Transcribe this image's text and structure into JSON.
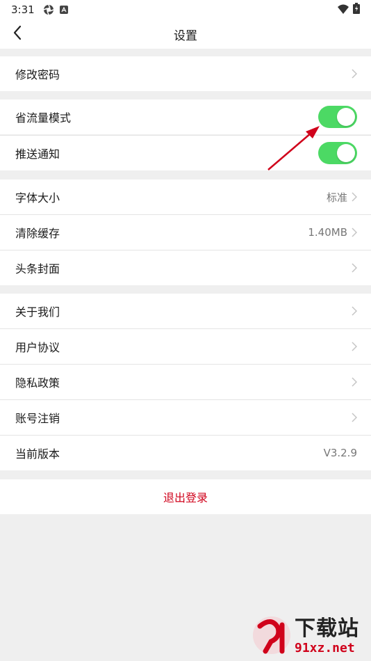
{
  "status_bar": {
    "time": "3:31"
  },
  "header": {
    "title": "设置"
  },
  "account": {
    "change_password": "修改密码"
  },
  "toggles": [
    {
      "label": "省流量模式",
      "on": true
    },
    {
      "label": "推送通知",
      "on": true
    }
  ],
  "display": {
    "font_size": {
      "label": "字体大小",
      "value": "标准"
    },
    "clear_cache": {
      "label": "清除缓存",
      "value": "1.40MB"
    },
    "headline_cover": {
      "label": "头条封面"
    }
  },
  "about": {
    "about_us": "关于我们",
    "user_agreement": "用户协议",
    "privacy_policy": "隐私政策",
    "account_cancel": "账号注销",
    "version": {
      "label": "当前版本",
      "value": "V3.2.9"
    }
  },
  "logout": {
    "label": "退出登录"
  },
  "watermark": {
    "brand": "下载站",
    "url": "91xz.net"
  },
  "colors": {
    "accent_red": "#d0021b",
    "toggle_green": "#4cd964"
  }
}
